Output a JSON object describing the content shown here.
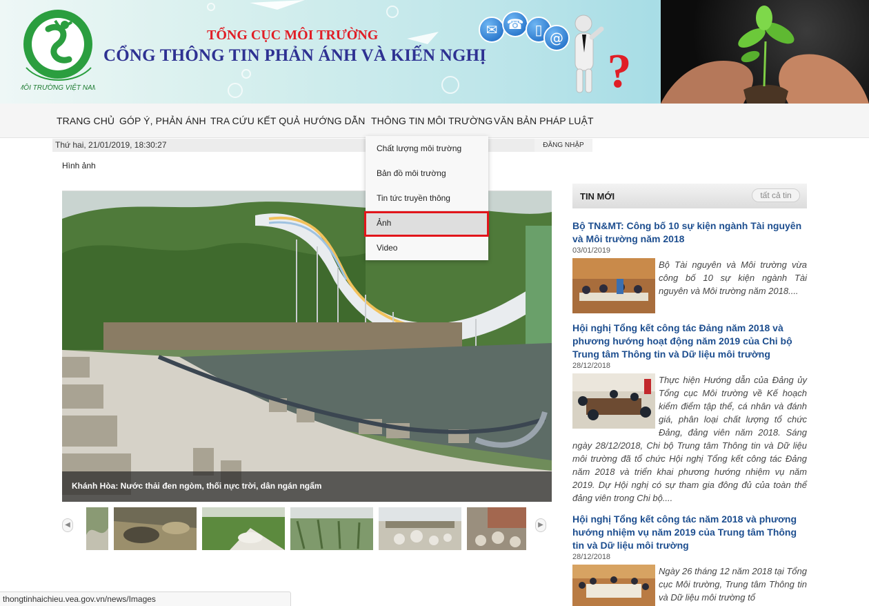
{
  "header": {
    "subtitle": "TỔNG CỤC MÔI TRƯỜNG",
    "title": "CỔNG THÔNG TIN PHẢN ÁNH VÀ KIẾN NGHỊ",
    "logo_text": "MÔI TRƯỜNG VIỆT NAM"
  },
  "nav": {
    "items": [
      {
        "label": "TRANG CHỦ"
      },
      {
        "label": "GÓP Ý, PHẢN ÁNH"
      },
      {
        "label": "TRA CỨU KẾT QUẢ"
      },
      {
        "label": "HƯỚNG DẪN"
      },
      {
        "label": "THÔNG TIN MÔI TRƯỜNG"
      },
      {
        "label": "VĂN BẢN PHÁP LUẬT"
      }
    ]
  },
  "datebar": {
    "date": "Thứ hai, 21/01/2019, 18:30:27",
    "login_label": "ĐĂNG NHẬP"
  },
  "dropdown": {
    "items": [
      {
        "label": "Chất lượng môi trường"
      },
      {
        "label": "Bản đồ môi trường"
      },
      {
        "label": "Tin tức truyền thông"
      },
      {
        "label": "Ảnh"
      },
      {
        "label": "Video"
      }
    ],
    "active_index": 3
  },
  "breadcrumb": "Hình ảnh",
  "slideshow": {
    "caption": "Khánh Hòa: Nước thải đen ngòm, thối nực trời, dân ngán ngẩm"
  },
  "news": {
    "heading": "TIN MỚI",
    "all_label": "tất cả tin",
    "items": [
      {
        "title": "Bộ TN&MT: Công bố 10 sự kiện ngành Tài nguyên và Môi trường năm 2018",
        "date": "03/01/2019",
        "summary": "Bộ Tài nguyên và Môi trường vừa công bố 10 sự kiện ngành Tài nguyên và Môi trường năm 2018...."
      },
      {
        "title": "Hội nghị Tổng kết công tác Đảng năm 2018 và phương hướng hoạt động năm 2019 của Chi bộ Trung tâm Thông tin và Dữ liệu môi trường",
        "date": "28/12/2018",
        "summary": "Thực hiện Hướng dẫn của Đảng ủy Tổng cục Môi trường về Kế hoạch kiểm điểm tập thể, cá nhân và đánh giá, phân loại chất lượng tổ chức Đảng, đảng viên năm 2018. Sáng ngày 28/12/2018, Chi bộ Trung tâm Thông tin và Dữ liệu môi trường đã tổ chức Hội nghị Tổng kết công tác Đảng năm 2018 và triển khai phương hướng nhiệm vụ năm 2019. Dự Hội nghị có sự tham gia đông đủ của toàn thể đảng viên trong Chi bộ...."
      },
      {
        "title": "Hội nghị Tổng kết công tác năm 2018 và phương hướng nhiệm vụ năm 2019 của Trung tâm Thông tin và Dữ liệu môi trường",
        "date": "28/12/2018",
        "summary": "Ngày 26 tháng 12 năm 2018 tại Tổng cục Môi trường, Trung tâm Thông tin và Dữ liệu môi trường tổ"
      }
    ]
  },
  "status_url": "thongtinhaichieu.vea.gov.vn/news/Images",
  "colors": {
    "title_blue": "#2e3192",
    "subtitle_red": "#e01e26",
    "news_link": "#1d4e8f",
    "highlight_red": "#e2151b"
  }
}
